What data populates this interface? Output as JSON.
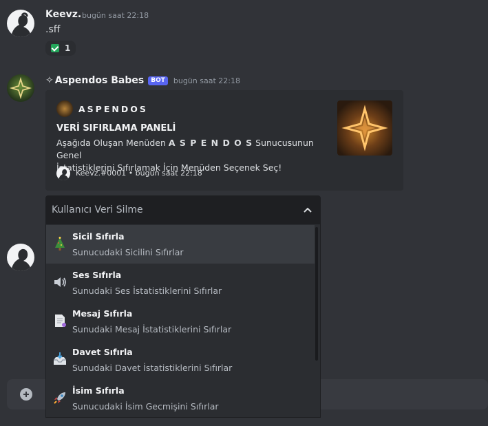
{
  "messages": [
    {
      "author": "Keevz.",
      "timestamp": "bugün saat 22:18",
      "content": ".sff",
      "reaction": {
        "emoji": "check-icon",
        "count": "1"
      }
    }
  ],
  "bot_message": {
    "author_prefix": "✧",
    "author": "Aspendos Babes",
    "badge": "BOT",
    "timestamp": "bugün saat 22:18",
    "embed": {
      "author_name": "ASPENDOS",
      "title": "VERİ SIFIRLAMA PANELİ",
      "desc_part1": "Aşağıda Oluşan Menüden ",
      "desc_bold": "A S P E N D O S",
      "desc_part2": " Sunucusunun Genel",
      "desc_line2": "İstatistiklerini Sıfırlamak İçin Menüden Seçenek Seç!",
      "footer_text": "Keevz.#0001 • bugün saat 22:18"
    },
    "select": {
      "placeholder": "Kullanıcı Veri Silme",
      "options": [
        {
          "title": "Sicil Sıfırla",
          "description": "Sunucudaki Sicilini Sıfırlar",
          "icon": "christmas-tree-icon"
        },
        {
          "title": "Ses Sıfırla",
          "description": "Sunudaki Ses İstatistiklerini Sıfırlar",
          "icon": "speaker-icon"
        },
        {
          "title": "Mesaj Sıfırla",
          "description": "Sunudaki Mesaj İstatistiklerini Sıfırlar",
          "icon": "page-icon"
        },
        {
          "title": "Davet Sıfırla",
          "description": "Sunudaki Davet İstatistiklerini Sıfırlar",
          "icon": "inbox-tray-icon"
        },
        {
          "title": "İsim Sıfırla",
          "description": "Sunucudaki İsim Gecmişini Sıfırlar",
          "icon": "rocket-icon"
        }
      ]
    }
  },
  "colors": {
    "background": "#313338",
    "embed": "#2b2d31",
    "select_header": "#1e1f22",
    "bot_badge": "#5865f2",
    "reaction_check": "#23a55a"
  }
}
